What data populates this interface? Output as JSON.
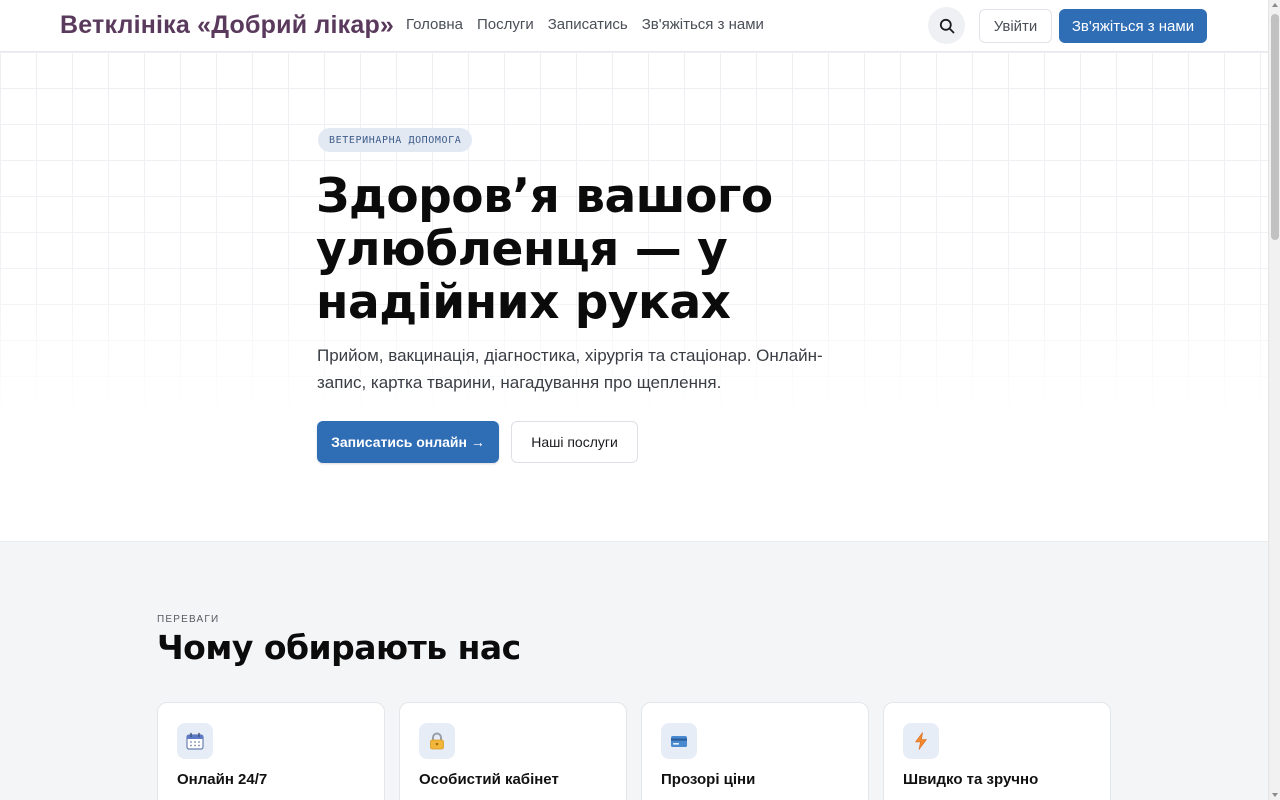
{
  "header": {
    "brand": "Ветклініка «Добрий лікар»",
    "nav": [
      {
        "label": "Головна"
      },
      {
        "label": "Послуги"
      },
      {
        "label": "Записатись"
      },
      {
        "label": "Зв'яжіться з нами"
      }
    ],
    "search_icon": "search-icon",
    "login_label": "Увійти",
    "contact_label": "Зв'яжіться з нами"
  },
  "hero": {
    "badge": "ВЕТЕРИНАРНА ДОПОМОГА",
    "title": "Здоров’я вашого улюбленця — у надійних руках",
    "subtitle": "Прийом, вакцинація, діагностика, хірургія та стаціонар. Онлайн-запис, картка тварини, нагадування про щеплення.",
    "primary_cta": "Записатись онлайн →",
    "secondary_cta": "Наші послуги"
  },
  "features": {
    "eyebrow": "ПЕРЕВАГИ",
    "title": "Чому обирають нас",
    "cards": [
      {
        "title": "Онлайн 24/7",
        "icon": "calendar-icon"
      },
      {
        "title": "Особистий кабінет",
        "icon": "lock-icon"
      },
      {
        "title": "Прозорі ціни",
        "icon": "credit-card-icon"
      },
      {
        "title": "Швидко та зручно",
        "icon": "lightning-icon"
      }
    ]
  },
  "colors": {
    "brand": "#5a3a5c",
    "accent": "#2f6db5",
    "badge_bg": "#e3e9f3",
    "section_bg": "#f4f5f7"
  }
}
